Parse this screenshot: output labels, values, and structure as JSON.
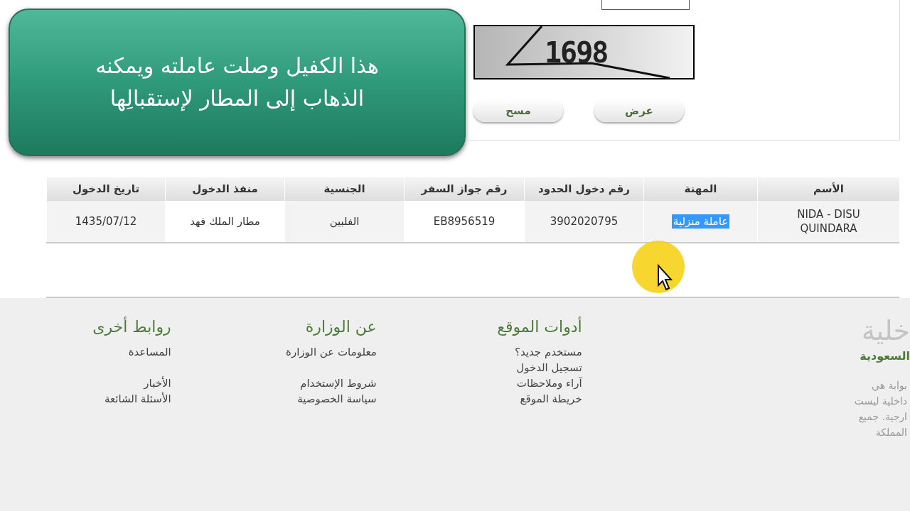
{
  "banner": {
    "lines": [
      "هذا الكفيل وصلت عاملته ويمكنه",
      "الذهاب إلى المطار لإستقبالِها"
    ]
  },
  "captcha": {
    "code": "1698"
  },
  "buttons": [
    {
      "label": "عرض"
    },
    {
      "label": "مسح"
    }
  ],
  "table": {
    "columns": [
      "الأسم",
      "المهنة",
      "رقم دخول الحدود",
      "رقم جواز السفر",
      "الجنسية",
      "منفذ الدخول",
      "تاريخ الدخول"
    ],
    "rows": [
      {
        "cells": [
          {
            "text": "NIDA - DISU QUINDARA",
            "highlighted": false
          },
          {
            "text": "عاملة منزلية",
            "highlighted": true
          },
          {
            "text": "3902020795",
            "highlighted": false
          },
          {
            "text": "EB8956519",
            "highlighted": false
          },
          {
            "text": "الفلبين",
            "highlighted": false
          },
          {
            "text": "مطار الملك فهد",
            "highlighted": false
          },
          {
            "text": "1435/07/12",
            "highlighted": false
          }
        ]
      }
    ]
  },
  "footer": {
    "brand": {
      "title": "خلية",
      "subtitle": "السعودية",
      "lines": [
        "بوابة هي",
        "داخلية ليست",
        "ارجية. جميع",
        "المملكة"
      ]
    },
    "columns": [
      {
        "title": "أدوات الموقع",
        "groups": [
          [
            "مستخدم جديد؟",
            "تسجيل الدخول",
            "آراء وملاحظات",
            "خريطة الموقع"
          ]
        ]
      },
      {
        "title": "عن الوزارة",
        "groups": [
          [
            "معلومات عن الوزارة"
          ],
          [
            "شروط الإستخدام",
            "سياسة الخصوصية"
          ]
        ]
      },
      {
        "title": "روابط أخرى",
        "groups": [
          [
            "المساعدة"
          ],
          [
            "الأخبار",
            "الأسئلة الشائعة"
          ]
        ]
      }
    ]
  }
}
